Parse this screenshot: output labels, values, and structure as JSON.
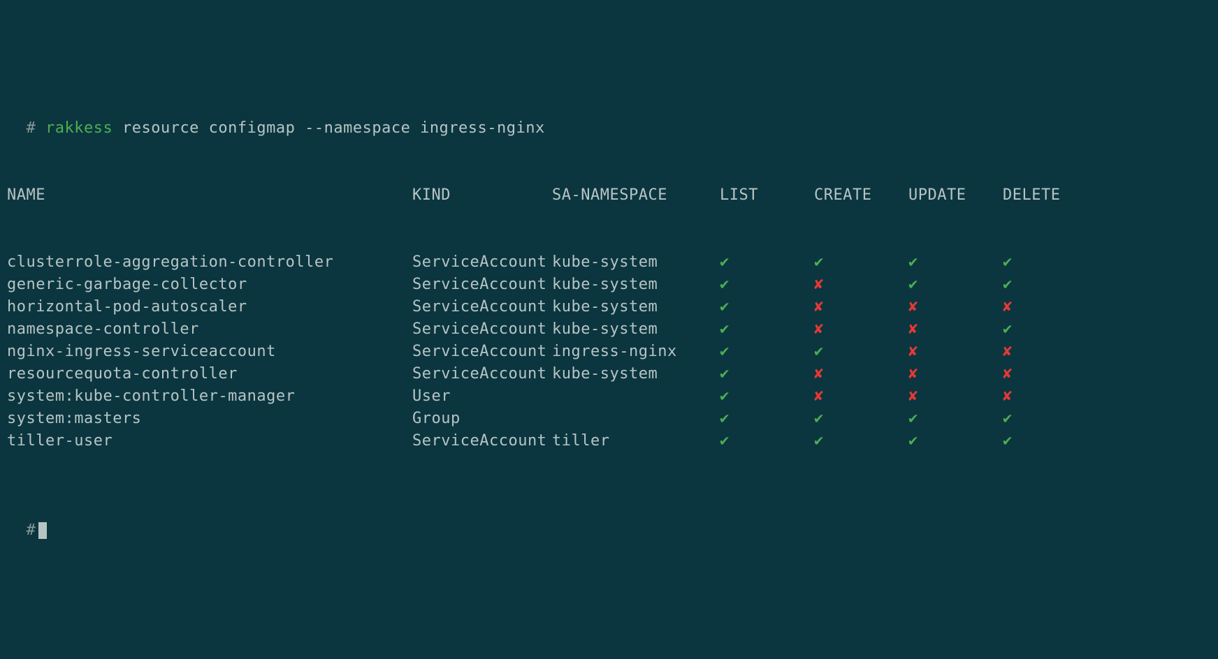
{
  "prompt": {
    "hash": "#",
    "command": "rakkess",
    "args": "resource configmap --namespace ingress-nginx"
  },
  "headers": {
    "name": "NAME",
    "kind": "KIND",
    "ns": "SA-NAMESPACE",
    "list": "LIST",
    "create": "CREATE",
    "update": "UPDATE",
    "delete": "DELETE"
  },
  "rows": [
    {
      "name": "clusterrole-aggregation-controller",
      "kind": "ServiceAccount",
      "ns": "kube-system",
      "perms": [
        "yes",
        "yes",
        "yes",
        "yes"
      ]
    },
    {
      "name": "generic-garbage-collector",
      "kind": "ServiceAccount",
      "ns": "kube-system",
      "perms": [
        "yes",
        "no",
        "yes",
        "yes"
      ]
    },
    {
      "name": "horizontal-pod-autoscaler",
      "kind": "ServiceAccount",
      "ns": "kube-system",
      "perms": [
        "yes",
        "no",
        "no",
        "no"
      ]
    },
    {
      "name": "namespace-controller",
      "kind": "ServiceAccount",
      "ns": "kube-system",
      "perms": [
        "yes",
        "no",
        "no",
        "yes"
      ]
    },
    {
      "name": "nginx-ingress-serviceaccount",
      "kind": "ServiceAccount",
      "ns": "ingress-nginx",
      "perms": [
        "yes",
        "yes",
        "no",
        "no"
      ]
    },
    {
      "name": "resourcequota-controller",
      "kind": "ServiceAccount",
      "ns": "kube-system",
      "perms": [
        "yes",
        "no",
        "no",
        "no"
      ]
    },
    {
      "name": "system:kube-controller-manager",
      "kind": "User",
      "ns": "",
      "perms": [
        "yes",
        "no",
        "no",
        "no"
      ]
    },
    {
      "name": "system:masters",
      "kind": "Group",
      "ns": "",
      "perms": [
        "yes",
        "yes",
        "yes",
        "yes"
      ]
    },
    {
      "name": "tiller-user",
      "kind": "ServiceAccount",
      "ns": "tiller",
      "perms": [
        "yes",
        "yes",
        "yes",
        "yes"
      ]
    }
  ],
  "glyphs": {
    "yes": "✔",
    "no": "✘"
  }
}
